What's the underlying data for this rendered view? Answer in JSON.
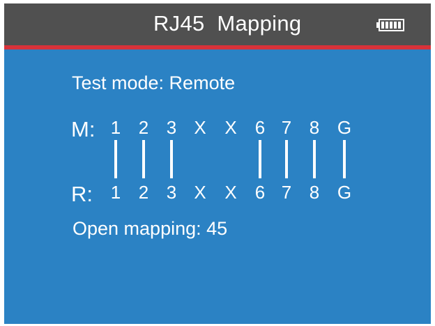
{
  "header": {
    "title": "RJ45  Mapping",
    "battery_icon": "battery-full-icon",
    "header_color": "#505050",
    "accent_line_color": "#d8323a",
    "screen_color": "#2b82c4"
  },
  "test_mode": "Test mode: Remote",
  "mapping": {
    "main_label": "M:",
    "remote_label": "R:",
    "main_pins": [
      "1",
      "2",
      "3",
      "X",
      "X",
      "6",
      "7",
      "8",
      "G"
    ],
    "remote_pins": [
      "1",
      "2",
      "3",
      "X",
      "X",
      "6",
      "7",
      "8",
      "G"
    ],
    "wires_connected": [
      true,
      true,
      true,
      false,
      false,
      true,
      true,
      true,
      true
    ]
  },
  "open_mapping": "Open mapping: 45"
}
